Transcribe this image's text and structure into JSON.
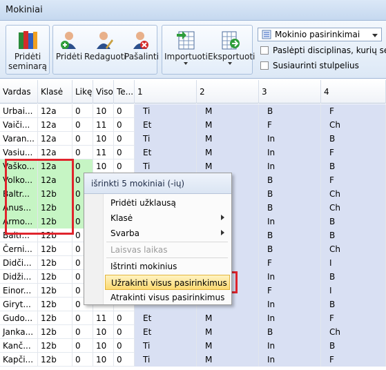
{
  "window": {
    "title": "Mokiniai"
  },
  "ribbon": {
    "add_seminar": {
      "label_line1": "Pridėti",
      "label_line2": "seminarą"
    },
    "add": "Pridėti",
    "edit": "Redaguoti",
    "remove": "Pašalinti",
    "import": "Importuoti",
    "export": "Eksportuoti",
    "mode_select": {
      "value": "Mokinio pasirinkimai"
    },
    "hide_disciplines": "Paslėpti disciplinas, kurių seminarai",
    "merge_columns": "Susiaurinti stulpelius"
  },
  "grid": {
    "columns": [
      "Vardas",
      "Klasė",
      "Likę",
      "Viso",
      "Te...",
      "1",
      "2",
      "3",
      "4"
    ],
    "rows": [
      [
        "Urbai...",
        "12a",
        "0",
        "10",
        "0",
        "Ti",
        "M",
        "B",
        "F"
      ],
      [
        "Vaiči...",
        "12a",
        "0",
        "11",
        "0",
        "Et",
        "M",
        "F",
        "Ch"
      ],
      [
        "Varan...",
        "12a",
        "0",
        "10",
        "0",
        "Ti",
        "M",
        "In",
        "B"
      ],
      [
        "Vasiu...",
        "12a",
        "0",
        "11",
        "0",
        "Et",
        "M",
        "In",
        "F"
      ],
      [
        "Vaško...",
        "12a",
        "0",
        "10",
        "0",
        "Ti",
        "M",
        "In",
        "B"
      ],
      [
        "Volko...",
        "12a",
        "0",
        "",
        "",
        "",
        "",
        "B",
        "F"
      ],
      [
        "Baltr...",
        "12b",
        "0",
        "",
        "",
        "",
        "",
        "B",
        "Ch"
      ],
      [
        "Anus...",
        "12b",
        "0",
        "",
        "",
        "",
        "",
        "B",
        "Ch"
      ],
      [
        "Armo...",
        "12b",
        "0",
        "",
        "",
        "",
        "",
        "In",
        "B"
      ],
      [
        "Baltr...",
        "12b",
        "0",
        "",
        "",
        "",
        "",
        "B",
        "B"
      ],
      [
        "Černi...",
        "12b",
        "0",
        "",
        "",
        "",
        "",
        "B",
        "Ch"
      ],
      [
        "Didči...",
        "12b",
        "0",
        "",
        "",
        "",
        "",
        "F",
        "I"
      ],
      [
        "Didži...",
        "12b",
        "0",
        "",
        "",
        "",
        "",
        "In",
        "B"
      ],
      [
        "Einor...",
        "12b",
        "0",
        "",
        "",
        "",
        "",
        "F",
        "I"
      ],
      [
        "Giryt...",
        "12b",
        "0",
        "",
        "",
        "",
        "",
        "In",
        "B"
      ],
      [
        "Gudo...",
        "12b",
        "0",
        "11",
        "0",
        "Et",
        "M",
        "In",
        "F"
      ],
      [
        "Janka...",
        "12b",
        "0",
        "10",
        "0",
        "Et",
        "M",
        "B",
        "Ch"
      ],
      [
        "Kanč...",
        "12b",
        "0",
        "10",
        "0",
        "Ti",
        "M",
        "In",
        "B"
      ],
      [
        "Kapči...",
        "12b",
        "0",
        "10",
        "0",
        "Ti",
        "M",
        "In",
        "F"
      ]
    ]
  },
  "context_menu": {
    "header": "išrinkti 5 mokiniai (-ių)",
    "items": [
      {
        "label": "Pridėti užklausą"
      },
      {
        "label": "Klasė"
      },
      {
        "label": "Svarba"
      },
      {
        "label": "Laisvas laikas"
      },
      {
        "label": "Ištrinti mokinius"
      },
      {
        "label": "Užrakinti visus pasirinkimus"
      },
      {
        "label": "Atrakinti visus pasirinkimus"
      }
    ]
  },
  "colors": {
    "selection_green": "#c6f5c4",
    "highlight_red": "#e0242c",
    "data_blue": "#d9e0f3"
  }
}
